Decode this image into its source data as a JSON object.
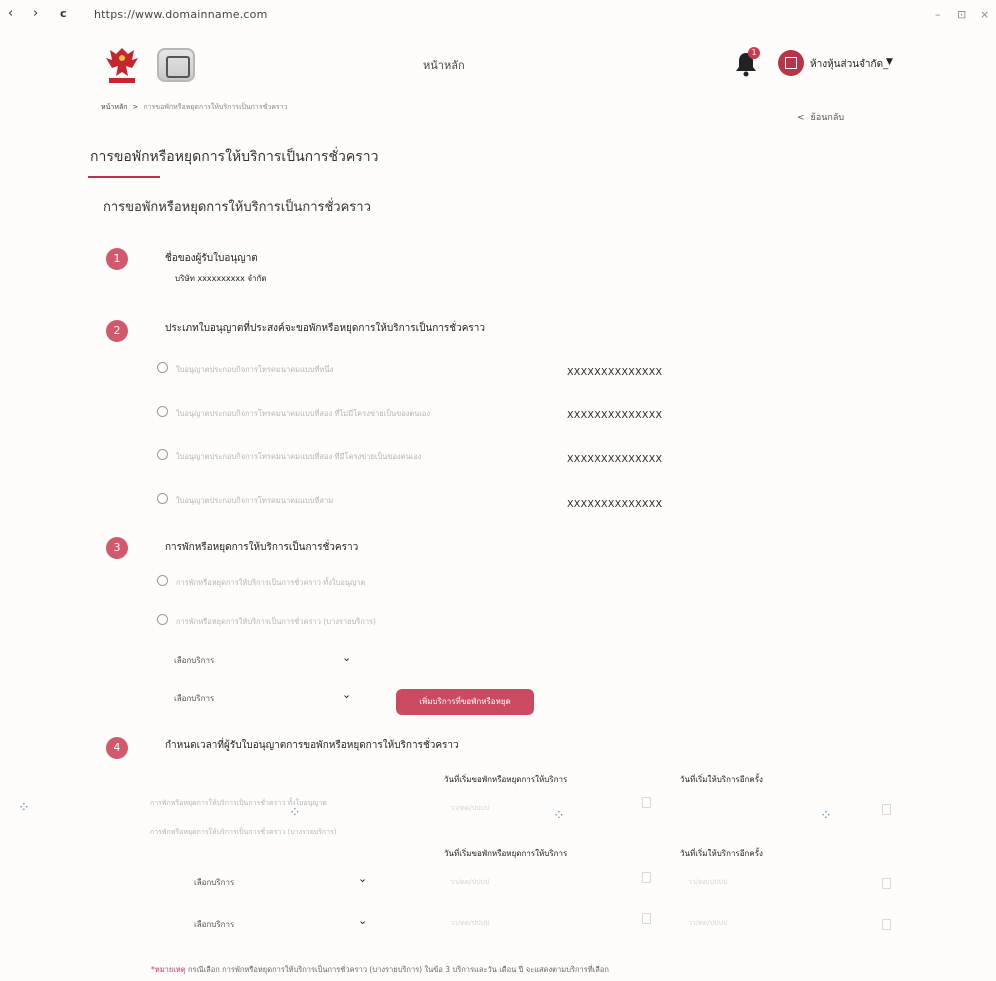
{
  "browser": {
    "back": "‹",
    "forward": "›",
    "reload": "c",
    "url": "https://www.domainname.com",
    "controls": [
      "–",
      "⊡",
      "×"
    ]
  },
  "header": {
    "home_link": "หน้าหลัก",
    "notification_count": "1",
    "company_name": "ห้างหุ้นส่วนจำกัด_"
  },
  "breadcrumb": {
    "home": "หน้าหลัก",
    "separator": ">",
    "current": "การขอพักหรือหยุดการให้บริการเป็นการชั่วคราว"
  },
  "back_label": "ย้อนกลับ",
  "page_title": "การขอพักหรือหยุดการให้บริการเป็นการชั่วคราว",
  "section_title": "การขอพักหรือหยุดการให้บริการเป็นการชั่วคราว",
  "steps": {
    "s1": {
      "num": "1",
      "title": "ชื่อของผู้รับใบอนุญาต",
      "value": "บริษัท xxxxxxxxxx จำกัด"
    },
    "s2": {
      "num": "2",
      "title": "ประเภทใบอนุญาตที่ประสงค์จะขอพักหรือหยุดการให้บริการเป็นการชั่วคราว",
      "options": [
        {
          "label": "ใบอนุญาตประกอบกิจการโทรคมนาคมแบบที่หนึ่ง",
          "code": "XXXXXXXXXXXXXX"
        },
        {
          "label": "ใบอนุญาตประกอบกิจการโทรคมนาคมแบบที่สอง ที่ไม่มีโครงข่ายเป็นของตนเอง",
          "code": "XXXXXXXXXXXXXX"
        },
        {
          "label": "ใบอนุญาตประกอบกิจการโทรคมนาคมแบบที่สอง ที่มีโครงข่ายเป็นของตนเอง",
          "code": "XXXXXXXXXXXXXX"
        },
        {
          "label": "ใบอนุญาตประกอบกิจการโทรคมนาคมแบบที่สาม",
          "code": "XXXXXXXXXXXXXX"
        }
      ]
    },
    "s3": {
      "num": "3",
      "title": "การพักหรือหยุดการให้บริการเป็นการชั่วคราว",
      "options": [
        "การพักหรือหยุดการให้บริการเป็นการชั่วคราว ทั้งใบอนุญาต",
        "การพักหรือหยุดการให้บริการเป็นการชั่วคราว (บางรายบริการ)"
      ],
      "selects": [
        "เลือกบริการ",
        "เลือกบริการ"
      ],
      "add_button": "เพิ่มบริการที่ขอพักหรือหยุด"
    },
    "s4": {
      "num": "4",
      "title": "กำหนดเวลาที่ผู้รับใบอนุญาตการขอพักหรือหยุดการให้บริการชั่วคราว",
      "start_col": "วันที่เริ่มขอพักหรือหยุดการให้บริการ",
      "resume_col": "วันที่เริ่มให้บริการอีกครั้ง",
      "row_whole": "การพักหรือหยุดการให้บริการเป็นการชั่วคราว ทั้งใบอนุญาต",
      "row_partial": "การพักหรือหยุดการให้บริการเป็นการชั่วคราว (บางรายบริการ)",
      "selects": [
        "เลือกบริการ",
        "เลือกบริการ"
      ],
      "date_placeholder": "วว/ดด/ปปปป"
    }
  },
  "note": {
    "star": "*หมายเหตุ",
    "text": " กรณีเลือก การพักหรือหยุดการให้บริการเป็นการชั่วคราว (บางรายบริการ) ในข้อ 3 บริการและวัน เดือน ปี จะแสดงตามบริการที่เลือก"
  },
  "colors": {
    "accent": "#cc4a5f",
    "step_circle": "#d2596c",
    "underline": "#b8344a"
  }
}
